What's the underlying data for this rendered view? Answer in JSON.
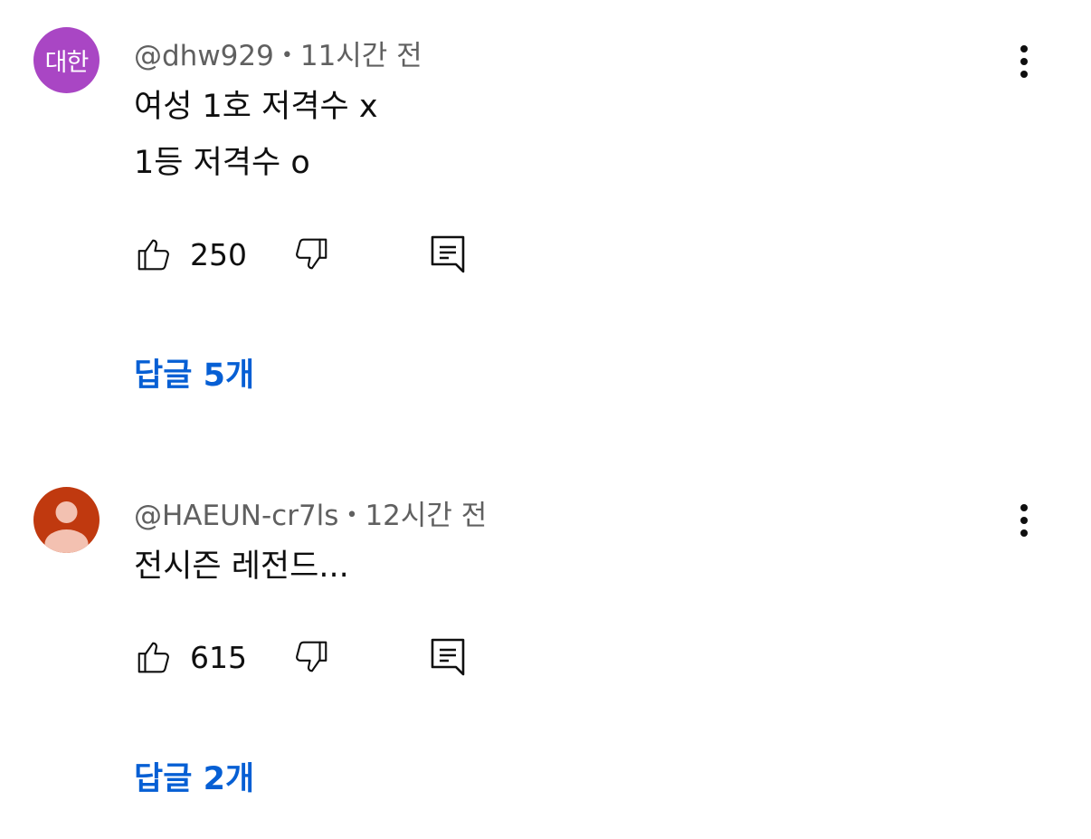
{
  "comments": [
    {
      "avatar_text": "대한",
      "avatar_color": "#a946c4",
      "handle": "@dhw929",
      "separator": "•",
      "time": "11시간 전",
      "lines": [
        "여성 1호 저격수 x",
        "1등 저격수 o"
      ],
      "likes": "250",
      "replies_label": "답글 5개"
    },
    {
      "avatar_color": "#c0390f",
      "handle": "@HAEUN-cr7ls",
      "separator": "•",
      "time": "12시간 전",
      "lines": [
        "전시즌 레전드..."
      ],
      "likes": "615",
      "replies_label": "답글 2개"
    }
  ],
  "colors": {
    "reply_link": "#065fd4",
    "meta_text": "#606060",
    "body_text": "#0f0f0f"
  },
  "icons": [
    "like-icon",
    "dislike-icon",
    "reply-icon",
    "more-vert-icon"
  ]
}
